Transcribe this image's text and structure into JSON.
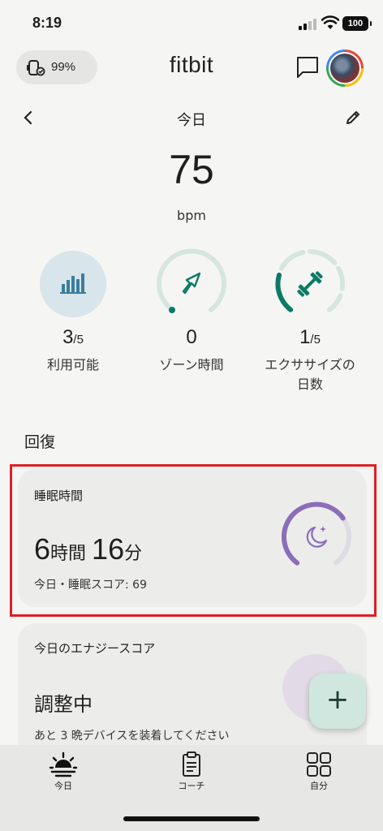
{
  "status_bar": {
    "time": "8:19",
    "battery": "100"
  },
  "header": {
    "device_battery": "99%",
    "brand": "fitbit"
  },
  "day_nav": {
    "title": "今日"
  },
  "heart_rate": {
    "value": "75",
    "unit": "bpm"
  },
  "metrics": [
    {
      "value": "3",
      "denominator": "/5",
      "label": "利用可能",
      "icon": "bar-chart-icon"
    },
    {
      "value": "0",
      "denominator": "",
      "label": "ゾーン時間",
      "icon": "zone-arrow-icon"
    },
    {
      "value": "1",
      "denominator": "/5",
      "label_line1": "エクササイズの",
      "label_line2": "日数",
      "icon": "dumbbell-icon",
      "progress": 0.2
    }
  ],
  "section": {
    "title": "回復"
  },
  "sleep_card": {
    "title": "睡眠時間",
    "hours": "6",
    "hours_unit": "時間",
    "minutes": "16",
    "minutes_unit": "分",
    "subtitle": "今日・睡眠スコア: 69",
    "score": 69,
    "icon": "moon-stars-icon"
  },
  "energy_card": {
    "title": "今日のエナジースコア",
    "status": "調整中",
    "message": "あと 3 晩デバイスを装着してください"
  },
  "fab": {
    "label": "+"
  },
  "bottom_nav": [
    {
      "label": "今日",
      "icon": "sunrise-icon"
    },
    {
      "label": "コーチ",
      "icon": "clipboard-icon"
    },
    {
      "label": "自分",
      "icon": "grid-icon"
    }
  ],
  "colors": {
    "accent_green": "#0b7a66",
    "ring_track": "#d5e6e1",
    "sleep_purple": "#8b6db8",
    "highlight_red": "#e01e24"
  }
}
